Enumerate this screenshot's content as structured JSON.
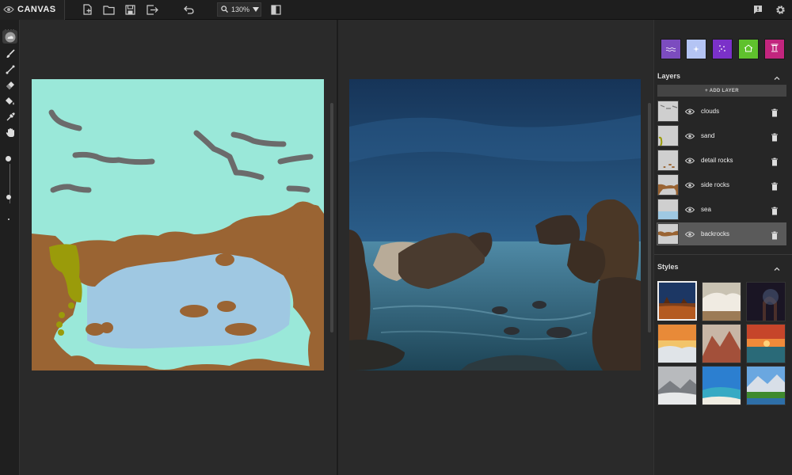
{
  "app": {
    "title": "CANVAS"
  },
  "toolbar": {
    "zoom_value": "130%",
    "icons": [
      "new-file-icon",
      "open-folder-icon",
      "save-icon",
      "export-icon",
      "undo-icon",
      "search-icon",
      "chevron-down-icon",
      "split-view-icon",
      "feedback-icon",
      "settings-icon"
    ]
  },
  "tools": [
    "drag-handle-icon",
    "material-icon",
    "brush-icon",
    "line-icon",
    "eraser-icon",
    "fill-icon",
    "eyedropper-icon",
    "pan-hand-icon"
  ],
  "colors": {
    "sky": "#9ae8d9",
    "clouds": "#6b6b6b",
    "rocks": "#9a6433",
    "sea": "#9fc8e2",
    "sand": "#9a9b0a",
    "material_1": "#7c4cbf",
    "material_2": "#b4c4f4",
    "material_3": "#7b31c9",
    "material_4": "#5fc12d",
    "material_5": "#c2257e"
  },
  "materials": [
    {
      "name": "water",
      "icon": "waves-icon"
    },
    {
      "name": "sky",
      "icon": "sparkle-icon"
    },
    {
      "name": "stars",
      "icon": "dots-icon"
    },
    {
      "name": "building",
      "icon": "house-icon"
    },
    {
      "name": "structure",
      "icon": "pillar-icon"
    }
  ],
  "layers_panel": {
    "title": "Layers",
    "add_label": "+ ADD LAYER",
    "items": [
      {
        "name": "clouds",
        "selected": false
      },
      {
        "name": "sand",
        "selected": false
      },
      {
        "name": "detail rocks",
        "selected": false
      },
      {
        "name": "side rocks",
        "selected": false
      },
      {
        "name": "sea",
        "selected": false
      },
      {
        "name": "backrocks",
        "selected": true
      }
    ]
  },
  "styles_panel": {
    "title": "Styles",
    "selected_index": 0
  }
}
